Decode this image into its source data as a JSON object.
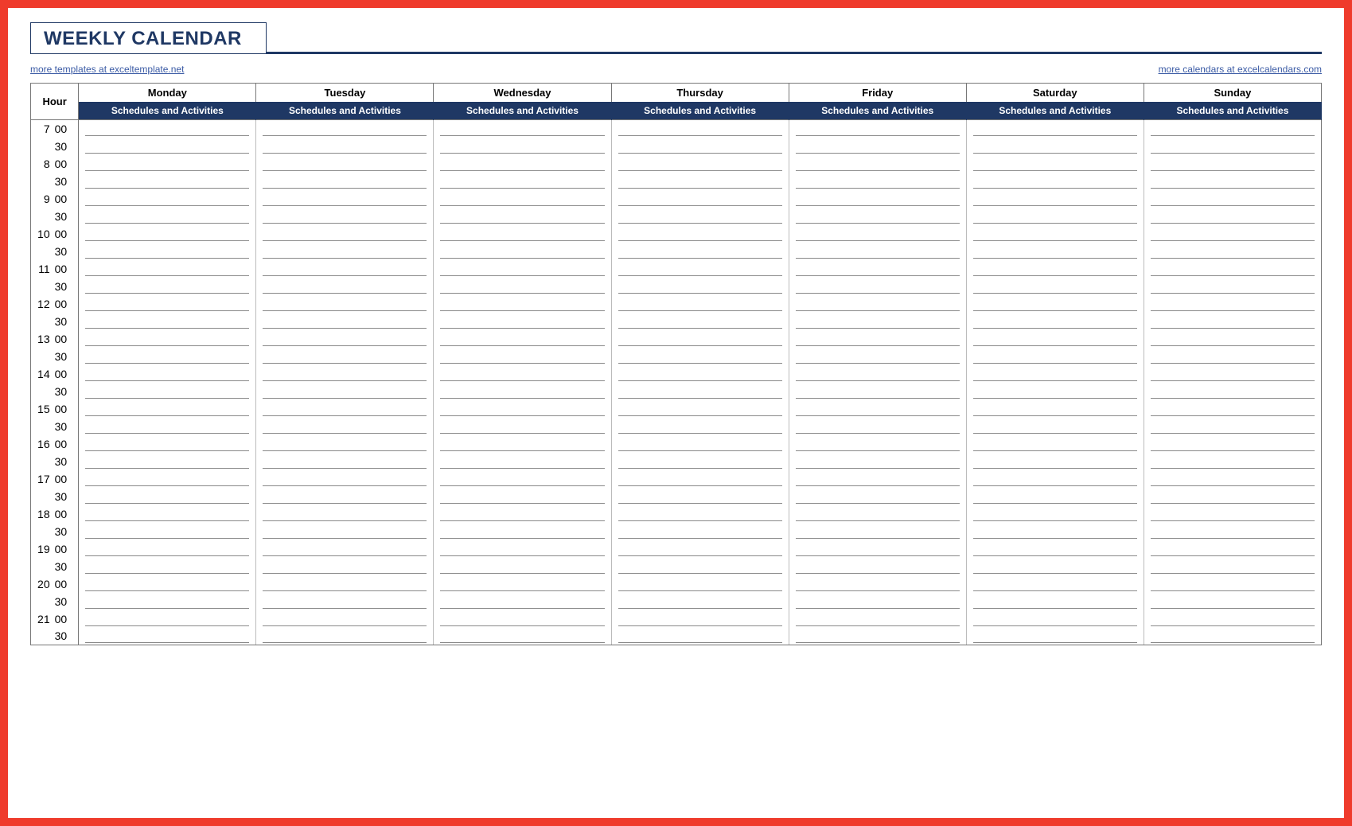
{
  "title": "WEEKLY CALENDAR",
  "links": {
    "left": "more templates at exceltemplate.net",
    "right": "more calendars at excelcalendars.com"
  },
  "hour_label": "Hour",
  "sub_header": "Schedules and Activities",
  "days": [
    "Monday",
    "Tuesday",
    "Wednesday",
    "Thursday",
    "Friday",
    "Saturday",
    "Sunday"
  ],
  "hours": [
    7,
    8,
    9,
    10,
    11,
    12,
    13,
    14,
    15,
    16,
    17,
    18,
    19,
    20,
    21
  ],
  "minutes": [
    "00",
    "30"
  ]
}
